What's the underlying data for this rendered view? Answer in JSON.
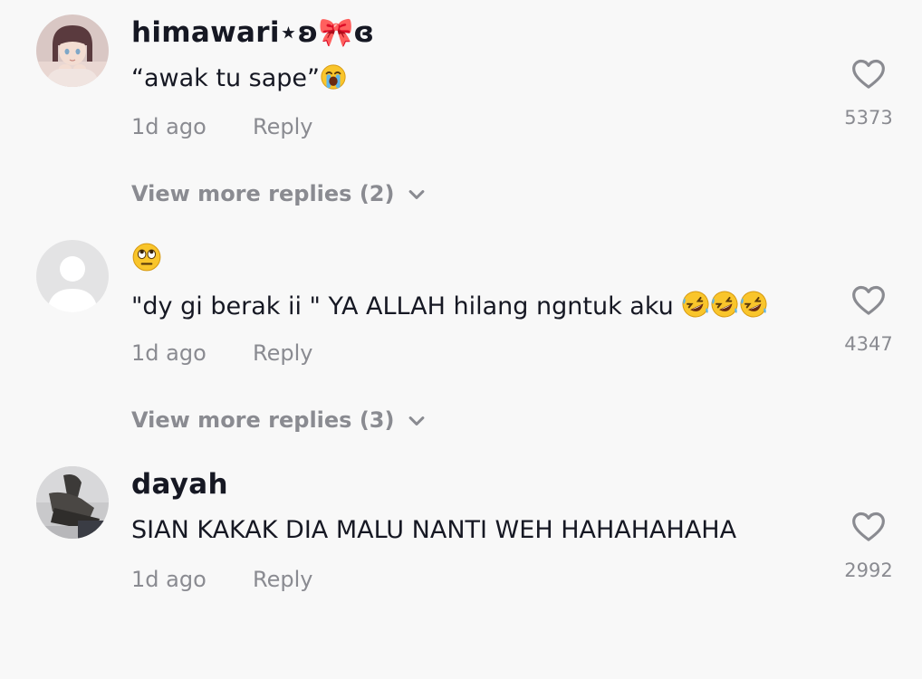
{
  "comments": [
    {
      "username": "himawari⋆ʚ🎀ɞ",
      "text": "“awak tu sape”",
      "emoji_after_text": "loudly-crying-face",
      "time": "1d ago",
      "reply_label": "Reply",
      "likes": "5373",
      "view_more": "View more replies (2)"
    },
    {
      "username": "",
      "emoji_line": "face-with-rolling-eyes",
      "text": "\"dy gi berak ii \" YA ALLAH hilang ngntuk aku",
      "emoji_after_text": "rolling-on-the-floor-laughing x3",
      "time": "1d ago",
      "reply_label": "Reply",
      "likes": "4347",
      "view_more": "View more replies (3)"
    },
    {
      "username": "dayah",
      "text": "SIAN KAKAK DIA MALU NANTI WEH HAHAHAHAHA",
      "time": "1d ago",
      "reply_label": "Reply",
      "likes": "2992"
    }
  ],
  "colors": {
    "background": "#f8f8f8",
    "primary_text": "#161823",
    "secondary_text": "#8a8b91"
  }
}
